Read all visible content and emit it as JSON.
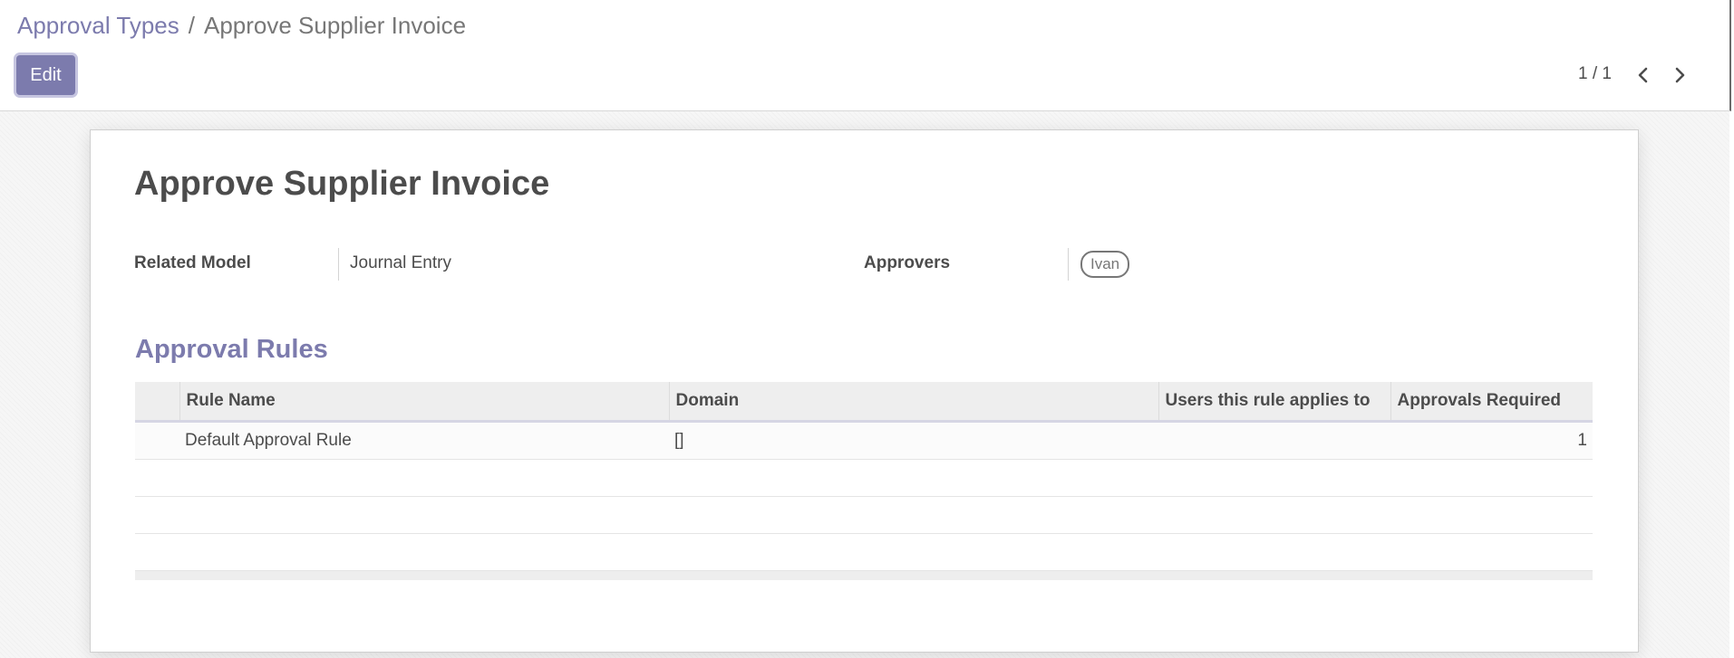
{
  "breadcrumb": {
    "parent": "Approval Types",
    "separator": "/",
    "current": "Approve Supplier Invoice"
  },
  "toolbar": {
    "edit_label": "Edit"
  },
  "pager": {
    "value": "1 / 1",
    "prev_icon": "chevron-left-icon",
    "next_icon": "chevron-right-icon"
  },
  "record": {
    "title": "Approve Supplier Invoice",
    "related_model_label": "Related Model",
    "related_model_value": "Journal Entry",
    "approvers_label": "Approvers",
    "approvers": [
      "Ivan"
    ]
  },
  "rules": {
    "section_title": "Approval Rules",
    "columns": [
      "Rule Name",
      "Domain",
      "Users this rule applies to",
      "Approvals Required"
    ],
    "rows": [
      {
        "name": "Default Approval Rule",
        "domain": "[]",
        "users": "",
        "approvals_required": "1"
      }
    ]
  },
  "colors": {
    "accent": "#7c7bad",
    "text": "#4c4c4c",
    "muted": "#777777"
  }
}
